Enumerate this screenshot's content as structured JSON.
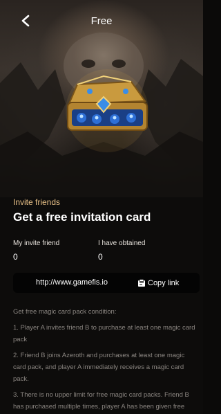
{
  "header": {
    "title": "Free"
  },
  "hero": {
    "image_name": "golden-treasure-chest",
    "accent_color": "#d4a44a"
  },
  "invite": {
    "label": "Invite friends",
    "headline": "Get a free invitation card"
  },
  "stats": {
    "my_invite_label": "My invite friend",
    "my_invite_value": "0",
    "obtained_label": "I have obtained",
    "obtained_value": "0"
  },
  "link": {
    "url": "http://www.gamefis.io",
    "copy_label": "Copy link",
    "copy_icon": "copy-icon"
  },
  "rules": {
    "heading": "Get free magic card pack condition:",
    "items": [
      "1. Player A invites friend B to purchase at least one magic card pack",
      "2. Friend B joins Azeroth and purchases at least one magic card pack, and player A immediately receives a magic card pack.",
      "3. There is no upper limit for free magic card packs. Friend B has purchased multiple times, player A has been given free"
    ]
  },
  "colors": {
    "gold_label": "#e6bf86",
    "background": "#0d0c0b",
    "rule_text": "#8a8580"
  }
}
